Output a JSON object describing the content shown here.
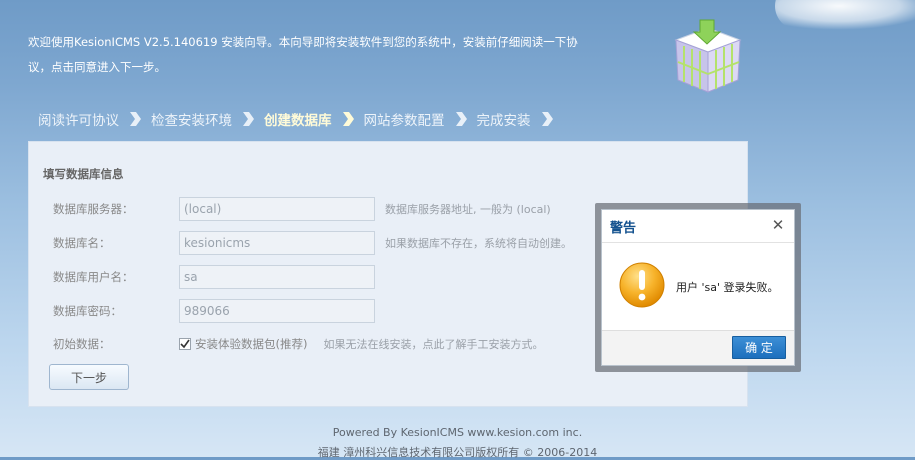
{
  "intro": {
    "line1": "欢迎使用KesionICMS V2.5.140619 安装向导。本向导即将安装软件到您的系统中，安装前仔细阅读一下协",
    "line2": "议，点击同意进入下一步。"
  },
  "steps": [
    {
      "label": "阅读许可协议",
      "active": false
    },
    {
      "label": "检查安装环境",
      "active": false
    },
    {
      "label": "创建数据库",
      "active": true
    },
    {
      "label": "网站参数配置",
      "active": false
    },
    {
      "label": "完成安装",
      "active": false
    }
  ],
  "form": {
    "title": "填写数据库信息",
    "server": {
      "label": "数据库服务器：",
      "value": "(local)",
      "hint": "数据库服务器地址, 一般为 (local)"
    },
    "dbname": {
      "label": "数据库名：",
      "value": "kesionicms",
      "hint": "如果数据库不存在，系统将自动创建。"
    },
    "user": {
      "label": "数据库用户名：",
      "value": "sa"
    },
    "password": {
      "label": "数据库密码：",
      "value": "989066"
    },
    "initdata": {
      "label": "初始数据：",
      "checkbox_label": "安装体验数据包(推荐)",
      "checked": true,
      "hint": "如果无法在线安装，点此了解手工安装方式。"
    },
    "next_label": "下一步"
  },
  "footer": {
    "line1": "Powered By KesionICMS www.kesion.com inc.",
    "line2": "福建 漳州科兴信息技术有限公司版权所有 © 2006-2014"
  },
  "dialog": {
    "title": "警告",
    "message": "用户 'sa' 登录失败。",
    "ok_label": "确 定",
    "icon": "warning-icon",
    "close_icon": "close-icon"
  },
  "colors": {
    "accent": "#14528f",
    "ok_button": "#2a80cc",
    "warning": "#f39c12"
  }
}
